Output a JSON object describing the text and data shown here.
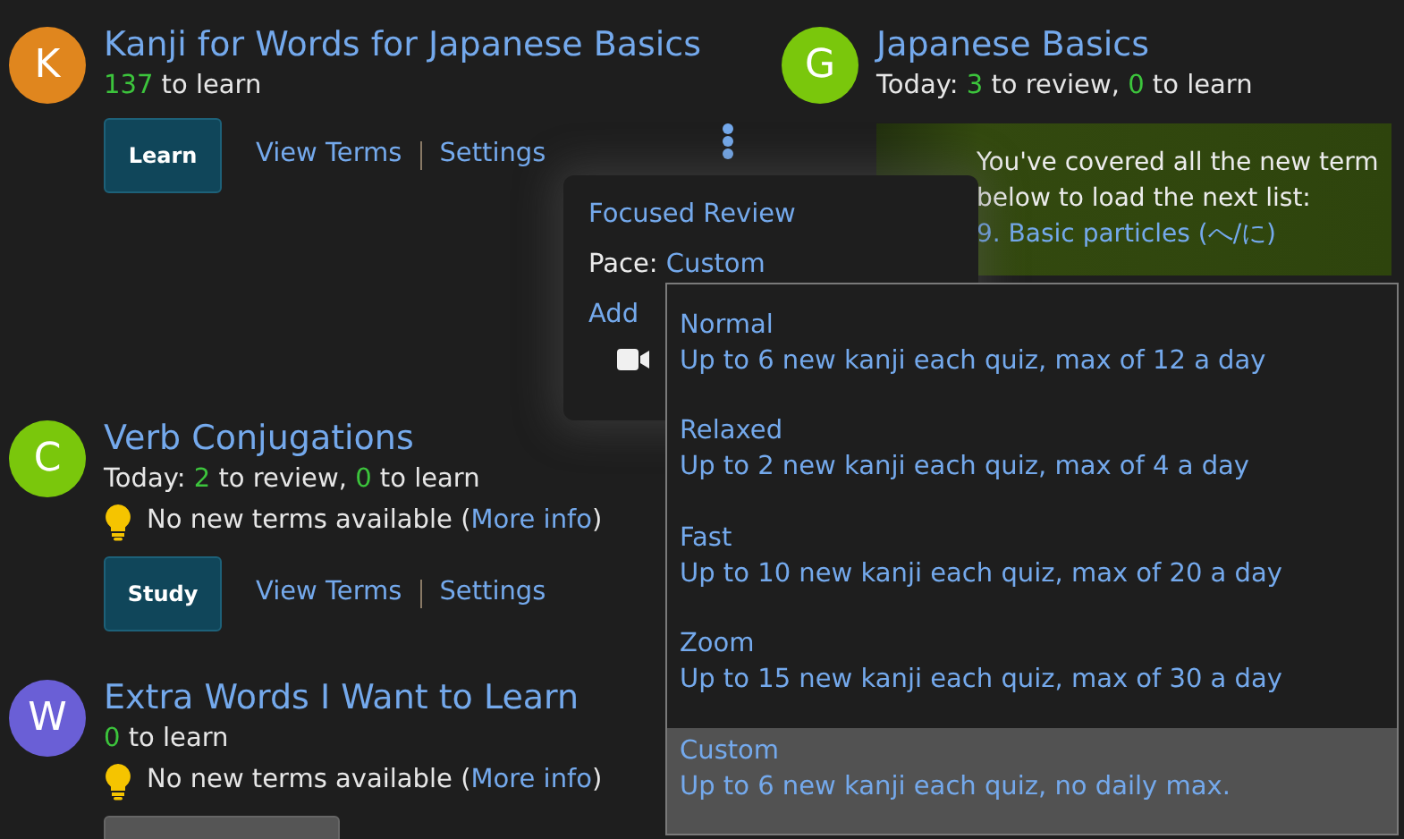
{
  "decks": [
    {
      "avatar": "K",
      "color": "#e0861e",
      "title": "Kanji for Words for Japanese Basics",
      "stats": [
        {
          "kind": "count",
          "text": "137"
        },
        {
          "kind": "plain",
          "text": " to learn"
        }
      ],
      "button": {
        "label": "Learn",
        "disabled": false
      },
      "links": [
        "View Terms",
        "Settings"
      ],
      "menu": true
    },
    {
      "avatar": "G",
      "color": "#7ac70c",
      "title": "Japanese Basics",
      "stats": [
        {
          "kind": "plain",
          "text": "Today: "
        },
        {
          "kind": "count",
          "text": "3"
        },
        {
          "kind": "plain",
          "text": " to review, "
        },
        {
          "kind": "count",
          "text": "0"
        },
        {
          "kind": "plain",
          "text": " to learn"
        }
      ],
      "notice": {
        "text": "You've covered all the new term",
        "text2": "below to load the next list:",
        "link": "9. Basic particles (へ/に)"
      }
    },
    {
      "avatar": "C",
      "color": "#7ac70c",
      "title": "Verb Conjugations",
      "stats": [
        {
          "kind": "plain",
          "text": "Today: "
        },
        {
          "kind": "count",
          "text": "2"
        },
        {
          "kind": "plain",
          "text": " to review, "
        },
        {
          "kind": "count",
          "text": "0"
        },
        {
          "kind": "plain",
          "text": " to learn"
        }
      ],
      "tip": {
        "text": "No new terms available (",
        "link": "More info",
        "end": ")"
      },
      "button": {
        "label": "Study",
        "disabled": false
      },
      "links": [
        "View Terms",
        "Settings"
      ]
    },
    {
      "avatar": "W",
      "color": "#6a5fd6",
      "title": "Extra Words I Want to Learn",
      "stats": [
        {
          "kind": "count",
          "text": "0"
        },
        {
          "kind": "plain",
          "text": " to learn"
        }
      ],
      "tip": {
        "text": "No new terms available (",
        "link": "More info",
        "end": ")"
      },
      "button": {
        "disabled": true
      }
    }
  ],
  "menu": {
    "items": [
      {
        "kind": "link",
        "text": "Focused Review"
      },
      {
        "kind": "pace",
        "label": "Pace:",
        "value": "Custom"
      },
      {
        "kind": "link",
        "text": "Add"
      },
      {
        "kind": "video"
      }
    ]
  },
  "pace_options": [
    {
      "name": "Normal",
      "description": "Up to 6 new kanji each quiz, max of 12 a day",
      "selected": false
    },
    {
      "name": "Relaxed",
      "description": "Up to 2 new kanji each quiz, max of 4 a day",
      "selected": false
    },
    {
      "name": "Fast",
      "description": "Up to 10 new kanji each quiz, max of 20 a day",
      "selected": false
    },
    {
      "name": "Zoom",
      "description": "Up to 15 new kanji each quiz, max of 30 a day",
      "selected": false
    },
    {
      "name": "Custom",
      "description": "Up to 6 new kanji each quiz, no daily max.",
      "selected": true
    }
  ]
}
